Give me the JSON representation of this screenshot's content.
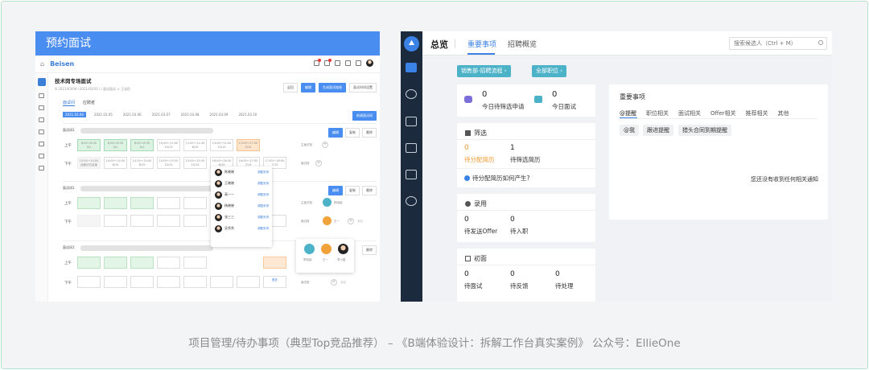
{
  "caption": "项目管理/待办事项（典型Top竞品推荐） – 《B端体验设计：拆解工作台真实案例》 公众号：EllieOne",
  "left": {
    "header": "预约面试",
    "brand": "Beisen",
    "title": "技术岗专场面试",
    "subtitle": "⏱ 2021/03/04~2021/03/10   ☐ 面试面试   ♙ 王忠民",
    "actions": [
      "返回",
      "编辑",
      "生成面试链接",
      "面试时间设置"
    ],
    "tabs": [
      "面试间",
      "应聘者"
    ],
    "dates": [
      "2021.03.04",
      "2021.03.05",
      "2021.03.06",
      "2021.03.07",
      "2021.03.08",
      "2021.03.09",
      "2021.03.10"
    ],
    "new_button": "新建面试间",
    "section_name": "面试间1",
    "section_actions": [
      "编辑",
      "复制",
      "删除"
    ],
    "row_am": "上午",
    "row_pm": "下午",
    "am_slots": [
      {
        "time": "8:00～8:30",
        "count": "0/1"
      },
      {
        "time": "8:00～8:30",
        "count": "0/1"
      },
      {
        "time": "8:00～8:30",
        "count": "0/1"
      },
      {
        "time": "10:00～11:00",
        "count": "10/15"
      },
      {
        "time": "11:00～11:30",
        "count": "8/15"
      },
      {
        "time": "13:00～11:00",
        "count": "10/15"
      },
      {
        "time": "17:00～17:30",
        "count": "0/15"
      }
    ],
    "pm_slots": [
      {
        "time": "13:00～14:00",
        "count": "此面试已结束"
      },
      {
        "time": "14:00～14:30",
        "count": "8/15"
      },
      {
        "time": "14:30～15:00",
        "count": "8/15"
      },
      {
        "time": "15:00～15:30",
        "count": "10/15"
      },
      {
        "time": "15:00～15:30",
        "count": "10/15"
      },
      {
        "time": "16:00～16:30",
        "count": "8/15"
      },
      {
        "time": "16:00～17:00",
        "count": "7/15"
      },
      {
        "time": "17:00～18:00",
        "count": "7/15"
      }
    ],
    "interviewer_label": "主面试官",
    "interviewer_label2": "面试官",
    "interviewer_name": "陈晓晓",
    "interviewer2": "王一",
    "add_label": "添加",
    "dropdown": [
      {
        "name": "陈晓晓",
        "action": "调整安排"
      },
      {
        "name": "王晓晓",
        "action": "调整安排"
      },
      {
        "name": "高一一",
        "action": "调整安排"
      },
      {
        "name": "杨晓晓",
        "action": "调整安排"
      },
      {
        "name": "张三三",
        "action": "调整安排"
      },
      {
        "name": "吴秀秀",
        "action": "调整安排"
      }
    ],
    "popcard": [
      "李晓晓",
      "王一",
      "李小星"
    ],
    "cell_action": "更多"
  },
  "right": {
    "title": "总览",
    "tab_active": "重要事项",
    "tab_other": "招聘概览",
    "search_placeholder": "搜索候选人（Ctrl + M）",
    "chip1": "销售部-招聘流程 ›",
    "chip2": "全部职位 ›",
    "stats": [
      {
        "value": "0",
        "label": "今日待筛选申请"
      },
      {
        "value": "0",
        "label": "今日面试"
      }
    ],
    "filter": {
      "title": "筛选",
      "items": [
        {
          "value": "0",
          "label": "待分配简历"
        },
        {
          "value": "1",
          "label": "待筛选简历"
        }
      ],
      "hint": "待分配简历如何产生?"
    },
    "hire": {
      "title": "录用",
      "items": [
        {
          "value": "0",
          "label": "待发送Offer"
        },
        {
          "value": "0",
          "label": "待入职"
        }
      ]
    },
    "first": {
      "title": "初面",
      "items": [
        {
          "value": "0",
          "label": "待面试"
        },
        {
          "value": "0",
          "label": "待反馈"
        },
        {
          "value": "0",
          "label": "待处理"
        }
      ]
    },
    "important": {
      "title": "重要事项",
      "tabs": [
        "@提醒",
        "职位相关",
        "面试相关",
        "Offer相关",
        "推荐相关",
        "其他"
      ],
      "pills": [
        "@我",
        "跟进提醒",
        "猎头合同到期提醒"
      ],
      "empty": "您还没有收到任何相关通知"
    }
  },
  "colors": {
    "accent": "#3b82e6",
    "header_blue": "#4a8df0",
    "sidebar_dark": "#1b2a3d",
    "chip_teal": "#4cb2c8",
    "orange": "#f29b30"
  }
}
